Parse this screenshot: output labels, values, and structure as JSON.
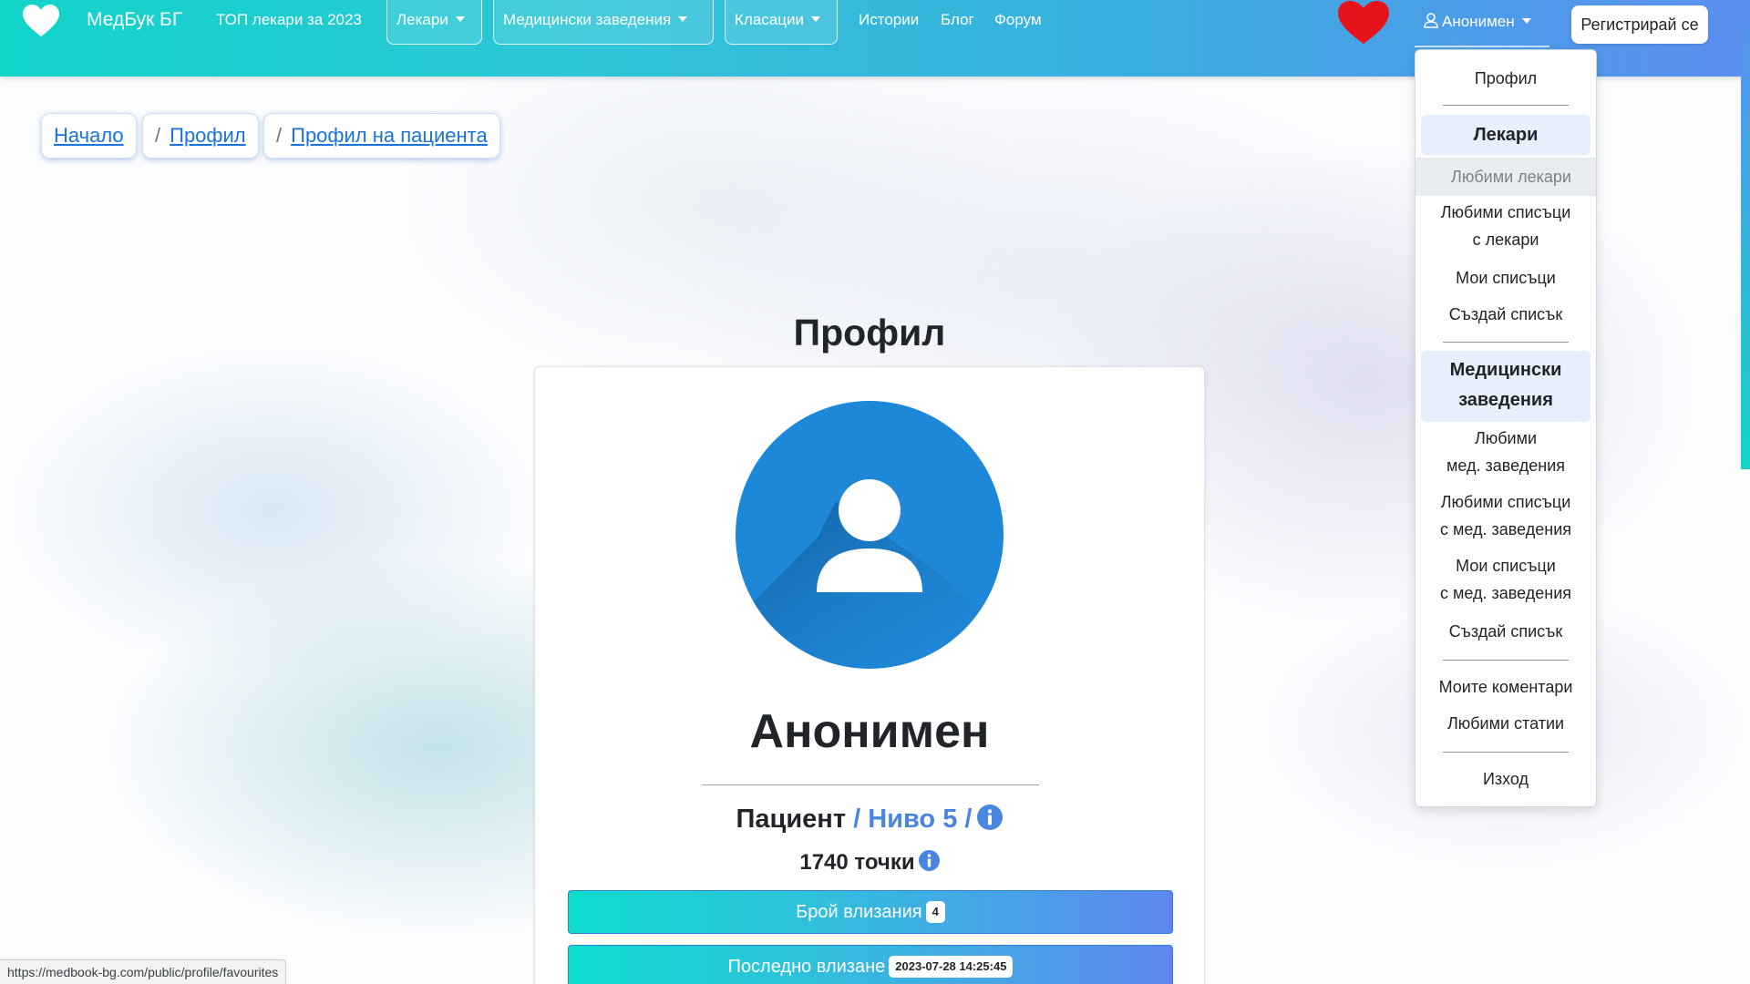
{
  "nav": {
    "brand": "МедБук БГ",
    "top_doctors": "ТОП лекари за 2023",
    "doctors": "Лекари",
    "facilities": "Медицински заведения",
    "rankings": "Класации",
    "stories": "Истории",
    "blog": "Блог",
    "forum": "Форум",
    "user": "Анонимен",
    "register": "Регистрирай се"
  },
  "breadcrumb": {
    "home": "Начало",
    "sep": "/",
    "profile": "Профил",
    "patient_profile": "Профил на пациента"
  },
  "profile": {
    "title": "Профил",
    "name": "Анонимен",
    "role": "Пациент",
    "level": "/ Ниво 5 /",
    "points": "1740 точки",
    "logins_label": "Брой влизания",
    "logins_value": "4",
    "last_login_label": "Последно влизане",
    "last_login_value": "2023-07-28 14:25:45"
  },
  "dropdown": {
    "profile": "Профил",
    "doctors_header": "Лекари",
    "fav_doctors": "Любими лекари",
    "fav_lists_doctors_1": "Любими списъци",
    "fav_lists_doctors_2": "с лекари",
    "my_lists": "Мои списъци",
    "create_list": "Създай списък",
    "facilities_header_1": "Медицински",
    "facilities_header_2": "заведения",
    "fav_facilities_1": "Любими",
    "fav_facilities_2": "мед. заведения",
    "fav_lists_fac_1": "Любими списъци",
    "fav_lists_fac_2": "с мед. заведения",
    "my_lists_fac_1": "Мои списъци",
    "my_lists_fac_2": "с мед. заведения",
    "create_list_fac": "Създай списък",
    "my_comments": "Моите коментари",
    "fav_articles": "Любими статии",
    "logout": "Изход"
  },
  "status_bar": {
    "url": "https://medbook-bg.com/public/profile/favourites"
  },
  "colors": {
    "nav_start": "#11d4c9",
    "nav_end": "#5b8ef0",
    "link": "#1a73d9",
    "level": "#4a86e0",
    "avatar": "#1e88d8",
    "heart": "#e8141c"
  },
  "icons": {
    "brand": "heart-icon",
    "favorites": "heart-icon",
    "user": "user-icon",
    "info": "info-circle-icon",
    "avatar": "user-avatar-icon"
  }
}
